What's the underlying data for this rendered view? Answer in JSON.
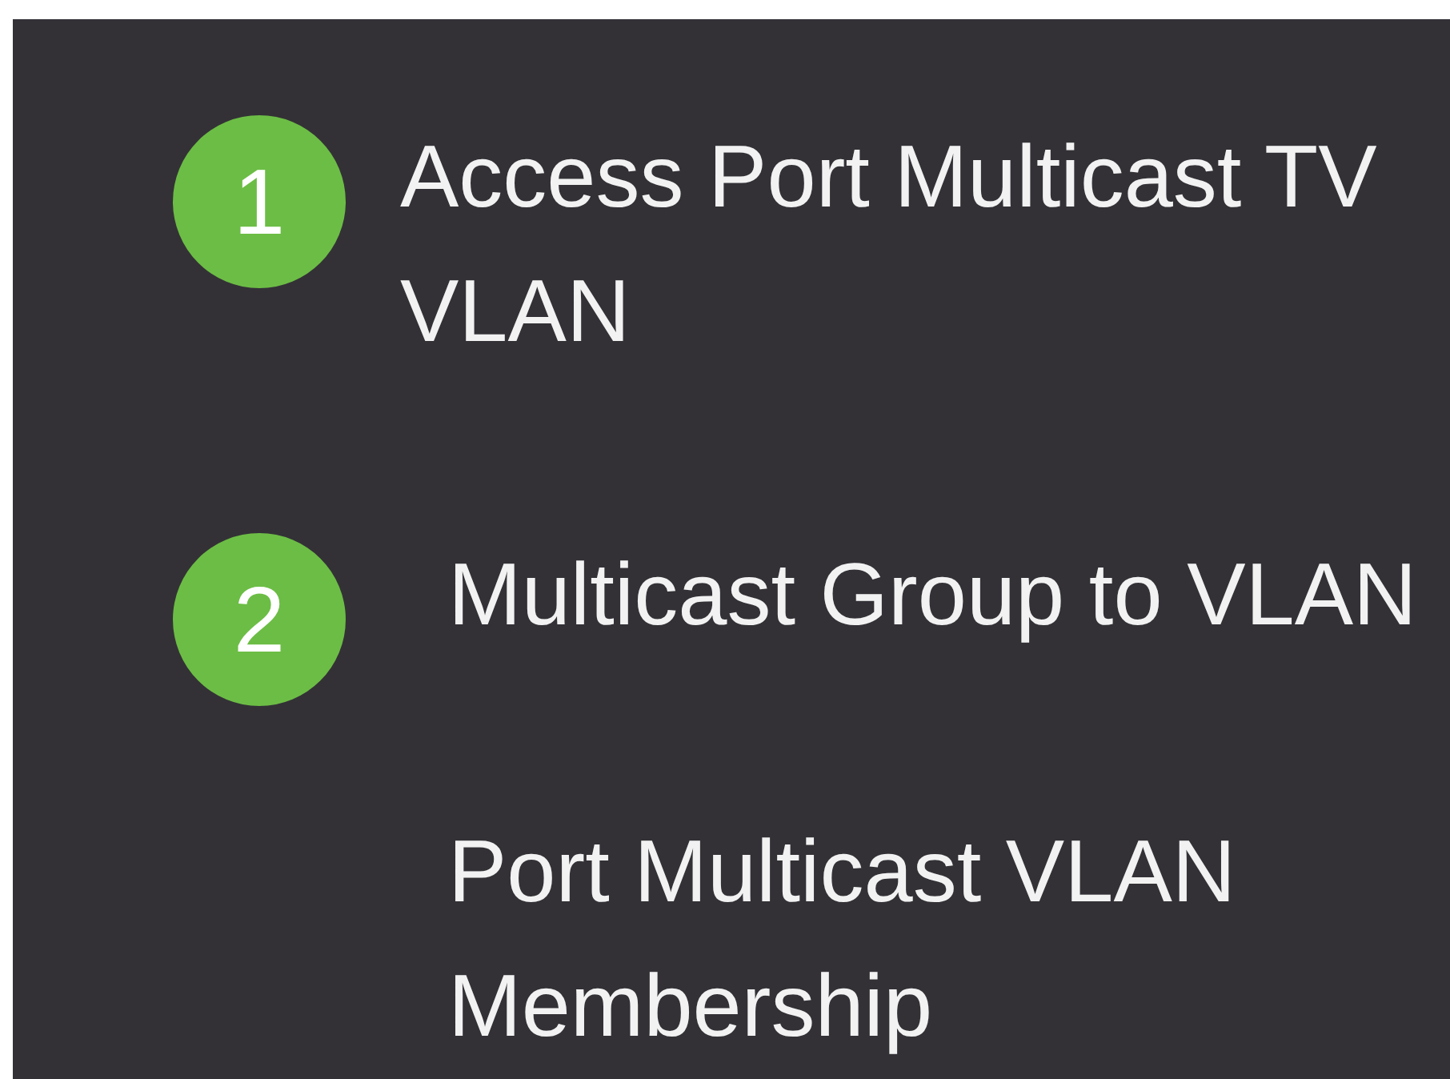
{
  "menu": {
    "items": [
      {
        "kind": "step",
        "number": "1",
        "label": "Access Port Multicast TV VLAN"
      },
      {
        "kind": "step",
        "number": "2",
        "label": "Multicast Group to VLAN"
      },
      {
        "kind": "plain",
        "label": "Port Multicast VLAN Membership"
      }
    ]
  }
}
